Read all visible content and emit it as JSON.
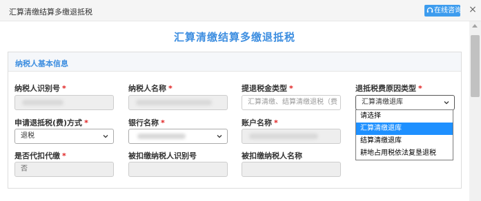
{
  "window": {
    "title": "汇算清缴结算多缴退抵税",
    "consult_label": "在线咨询"
  },
  "page": {
    "heading": "汇算清缴结算多缴退抵税"
  },
  "section": {
    "title": "纳税人基本信息"
  },
  "form": {
    "taxpayer_id": {
      "label": "纳税人识别号",
      "value": ""
    },
    "taxpayer_name": {
      "label": "纳税人名称",
      "value": ""
    },
    "refund_tax_type": {
      "label": "提退税金类型",
      "placeholder": "汇算清缴、结算清缴退税（费"
    },
    "refund_reason_type": {
      "label": "退抵税费原因类型",
      "value": "汇算清缴退库",
      "options": [
        "请选择",
        "汇算清缴退库",
        "结算清缴退库",
        "耕地占用税依法复垦退税"
      ],
      "highlighted_index": 1
    },
    "refund_method": {
      "label": "申请退抵税(费)方式",
      "value": "退税"
    },
    "bank_name": {
      "label": "银行名称",
      "value": ""
    },
    "account_name": {
      "label": "账户名称"
    },
    "withholding": {
      "label": "是否代扣代缴",
      "value": "否"
    },
    "withheld_taxpayer_id": {
      "label": "被扣缴纳税人识别号",
      "value": ""
    },
    "withheld_taxpayer_name": {
      "label": "被扣缴纳税人名称",
      "value": ""
    }
  },
  "colors": {
    "accent": "#3d8ee0",
    "button": "#3d9cee",
    "required": "#e02020",
    "selected_option": "#1e90ff"
  }
}
